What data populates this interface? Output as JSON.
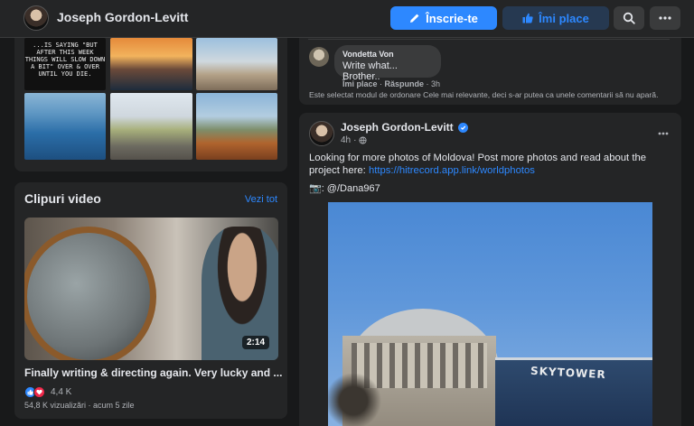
{
  "header": {
    "profile_name": "Joseph Gordon-Levitt",
    "register_label": "Înscrie-te",
    "like_label": "Îmi place",
    "icons": {
      "search": "search-icon",
      "more": "more-dots-icon",
      "pen": "pen-icon",
      "thumb": "thumbs-up-icon"
    },
    "colors": {
      "primary": "#2d88ff",
      "like_bg": "#263951"
    }
  },
  "photos": {
    "quote_text": "...IS SAYING \"BUT AFTER THIS WEEK THINGS WILL SLOW DOWN A BIT\" OVER & OVER UNTIL YOU DIE."
  },
  "videos": {
    "title": "Clipuri video",
    "see_all": "Vezi tot",
    "duration": "2:14",
    "caption": "Finally writing & directing again. Very lucky and ...",
    "reaction_count": "4,4 K",
    "meta": "54,8 K vizualizări · acum 5 zile"
  },
  "comment": {
    "name": "Vondetta Von",
    "text": "Write what... Brother..",
    "like": "Îmi place",
    "reply": "Răspunde",
    "time": "3h",
    "sort_note": "Este selectat modul de ordonare Cele mai relevante, deci s-ar putea ca unele comentarii să nu apară."
  },
  "post": {
    "author": "Joseph Gordon-Levitt",
    "time": "4h",
    "text": "Looking for more photos of Moldova! Post more photos and read about the project here: ",
    "link": "https://hitrecord.app.link/worldphotos",
    "credit": "📷: @/Dana967",
    "photo_sign": "SKYTOWER"
  }
}
